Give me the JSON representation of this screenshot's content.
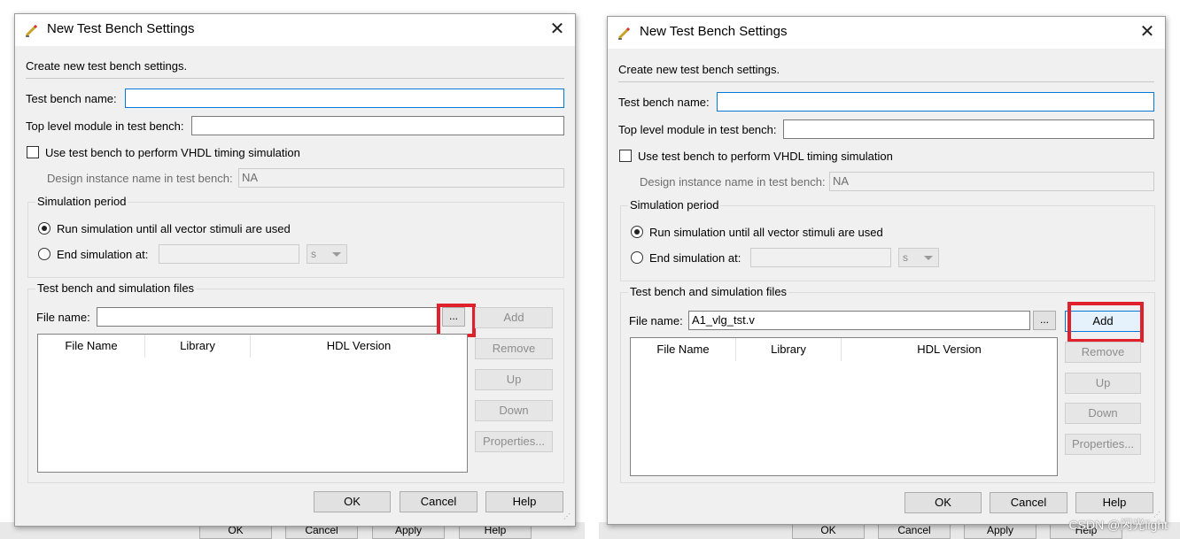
{
  "dialog": {
    "title": "New Test Bench Settings",
    "close_symbol": "✕",
    "description": "Create new test bench settings.",
    "test_bench_name_label": "Test bench name:",
    "top_level_module_label": "Top level module in test bench:",
    "vhdl_timing_checkbox_label": "Use test bench to perform VHDL timing simulation",
    "design_instance_label": "Design instance name in test bench:",
    "design_instance_value": "NA",
    "simulation_period": {
      "group_title": "Simulation period",
      "run_until_label": "Run simulation until all vector stimuli are used",
      "end_at_label": "End simulation at:",
      "time_unit": "s"
    },
    "files_group": {
      "group_title": "Test bench and simulation files",
      "file_name_label": "File name:",
      "browse_label": "...",
      "columns": [
        "File Name",
        "Library",
        "HDL Version"
      ],
      "buttons": {
        "add": "Add",
        "remove": "Remove",
        "up": "Up",
        "down": "Down",
        "properties": "Properties..."
      }
    },
    "footer": {
      "ok": "OK",
      "cancel": "Cancel",
      "help": "Help"
    }
  },
  "left_panel": {
    "file_name_value": ""
  },
  "right_panel": {
    "file_name_value": "A1_vlg_tst.v"
  },
  "background_buttons": [
    "OK",
    "Cancel",
    "Apply",
    "Help"
  ],
  "watermark": "CSDN @闪光light",
  "colors": {
    "highlight": "#e0202a",
    "focus": "#0078d7",
    "dialog_bg": "#f0f0f0"
  }
}
